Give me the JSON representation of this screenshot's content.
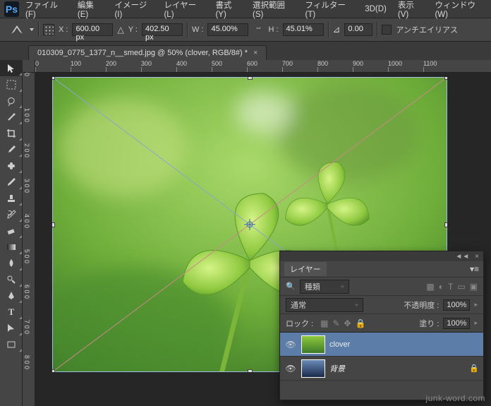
{
  "menu": {
    "items": [
      "ファイル(F)",
      "編集(E)",
      "イメージ(I)",
      "レイヤー(L)",
      "書式(Y)",
      "選択範囲(S)",
      "フィルター(T)",
      "3D(D)",
      "表示(V)",
      "ウィンドウ(W)"
    ]
  },
  "options": {
    "x_label": "X :",
    "x_value": "600.00 px",
    "y_label": "Y :",
    "y_value": "402.50 px",
    "w_label": "W :",
    "w_value": "45.00%",
    "h_label": "H :",
    "h_value": "45.01%",
    "a_value": "0.00",
    "antialias": "アンチエイリアス"
  },
  "tab": {
    "title": "010309_0775_1377_n__smed.jpg @ 50% (clover, RGB/8#) *"
  },
  "rulers": {
    "h": [
      "0",
      "100",
      "200",
      "300",
      "400",
      "500",
      "600",
      "700",
      "800",
      "900",
      "1000",
      "1100"
    ],
    "v": [
      "0",
      "1 0 0",
      "2 0 0",
      "3 0 0",
      "4 0 0",
      "5 0 0",
      "6 0 0",
      "7 0 0",
      "8 0 0"
    ]
  },
  "layers": {
    "panel_title": "レイヤー",
    "kind": "種類",
    "blend": "通常",
    "opacity_label": "不透明度 :",
    "opacity_value": "100%",
    "lock_label": "ロック :",
    "fill_label": "塗り :",
    "fill_value": "100%",
    "items": [
      {
        "name": "clover",
        "locked": false
      },
      {
        "name": "背景",
        "locked": true
      }
    ]
  },
  "watermark": "junk-word.com"
}
